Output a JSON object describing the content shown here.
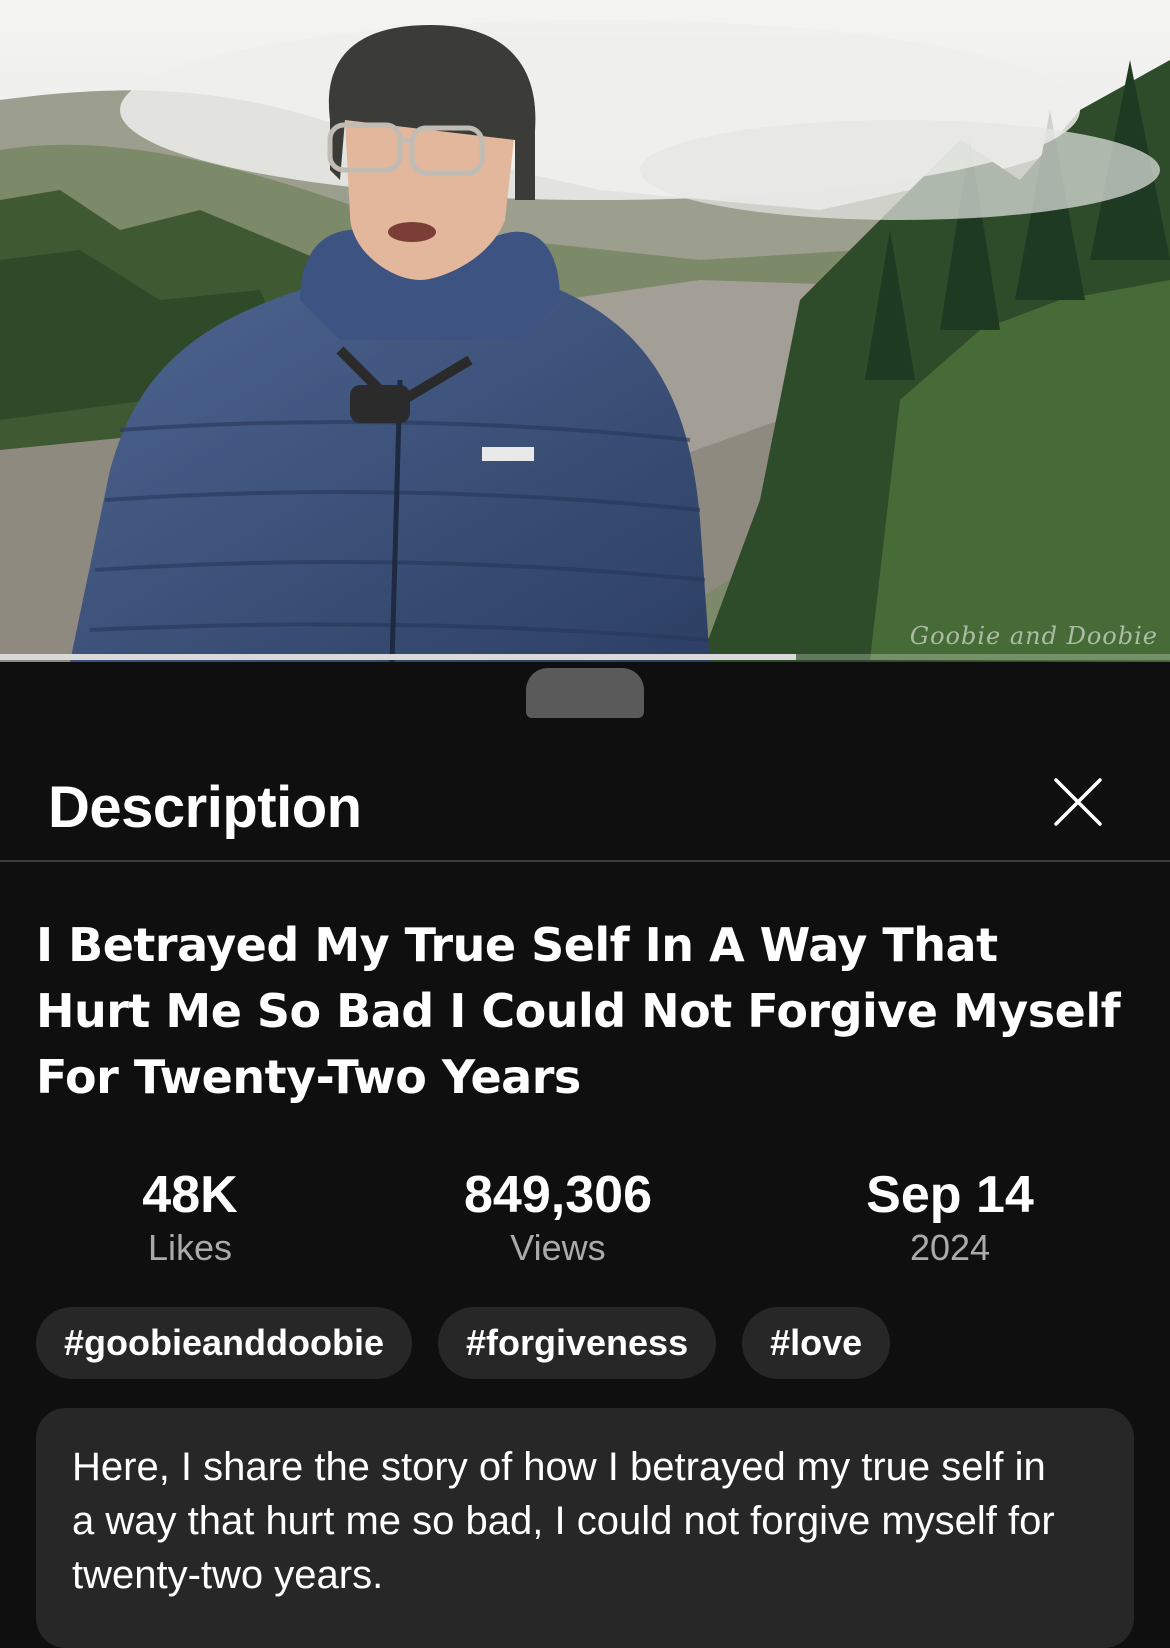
{
  "video": {
    "watermark": "Goobie and Doobie",
    "progress_fraction": 0.68
  },
  "sheet": {
    "title": "Description",
    "close_label": "Close"
  },
  "video_info": {
    "title": "I Betrayed My True Self In A Way That Hurt Me So Bad I Could Not Forgive Myself For Twenty-Two Years",
    "stats": [
      {
        "value": "48K",
        "label": "Likes"
      },
      {
        "value": "849,306",
        "label": "Views"
      },
      {
        "value": "Sep 14",
        "label": "2024"
      }
    ],
    "hashtags": [
      "#goobieanddoobie",
      "#forgiveness",
      "#love"
    ],
    "description": "Here, I share the story of how I betrayed my true self in a way that hurt me so bad, I could not forgive myself for twenty-two years."
  },
  "icons": {
    "close": "close-icon"
  },
  "colors": {
    "background": "#0f0f0f",
    "chip": "#272727",
    "secondary_text": "#aaaaaa"
  }
}
